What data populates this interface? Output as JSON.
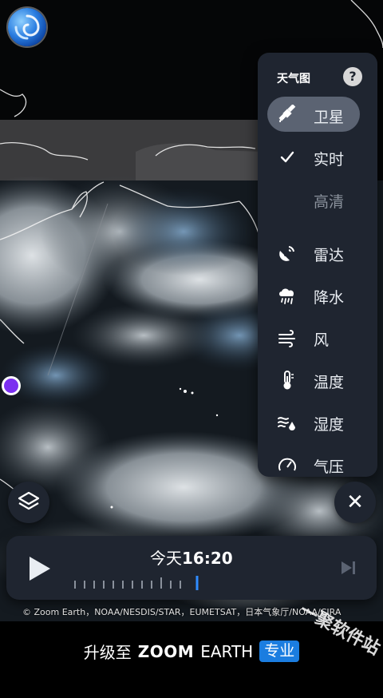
{
  "menu": {
    "title": "天气图",
    "help_label": "?",
    "items": [
      {
        "label": "卫星",
        "icon": "satellite-icon",
        "active": true
      },
      {
        "label": "实时",
        "icon": "check-icon",
        "active": false
      },
      {
        "label": "高清",
        "icon": "",
        "active": false
      },
      {
        "label": "雷达",
        "icon": "radar-icon",
        "active": false
      },
      {
        "label": "降水",
        "icon": "precipitation-icon",
        "active": false
      },
      {
        "label": "风",
        "icon": "wind-icon",
        "active": false
      },
      {
        "label": "温度",
        "icon": "thermometer-icon",
        "active": false
      },
      {
        "label": "湿度",
        "icon": "humidity-icon",
        "active": false
      },
      {
        "label": "气压",
        "icon": "gauge-icon",
        "active": false
      }
    ]
  },
  "timeline": {
    "day": "今天",
    "time": "16:20"
  },
  "credits": "© Zoom Earth，NOAA/NESDIS/STAR，EUMETSAT，日本气象厅/NOAA/CIRA",
  "upgrade": {
    "prefix": "升级至",
    "brand_bold": "ZOOM",
    "brand_light": "EARTH",
    "badge": "专业"
  },
  "watermark": "一聚软件站",
  "colors": {
    "panel_bg": "#1f2530",
    "active_item": "#5b6372",
    "accent_blue": "#1b7de0",
    "location_dot": "#7b2ff0",
    "timeline_marker": "#2f8cff"
  }
}
